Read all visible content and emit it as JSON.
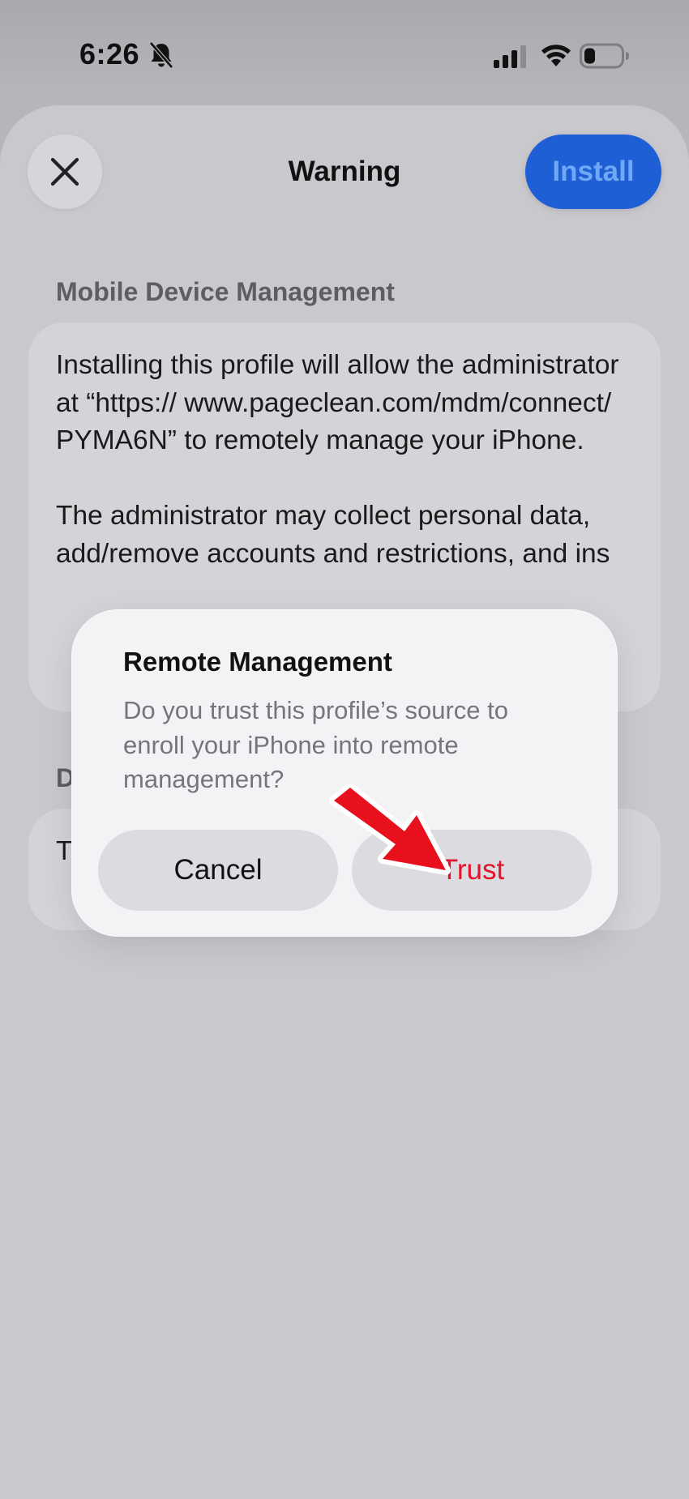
{
  "status_bar": {
    "time": "6:26"
  },
  "sheet": {
    "title": "Warning",
    "close_icon": "close-icon",
    "install_label": "Install",
    "accent_color": "#1f5fd6"
  },
  "mdm_section": {
    "header": "Mobile Device Management",
    "paragraph1": "Installing this profile will allow the administrator at “https:// www.pageclean.com/mdm/connect/ PYMA6N” to remotely manage your iPhone.",
    "paragraph2": "The administrator may collect personal data, add/remove accounts and restrictions, and ins"
  },
  "second_section": {
    "header": "D",
    "text": "T"
  },
  "alert": {
    "title": "Remote Management",
    "message": "Do you trust this profile’s source to enroll your iPhone into remote management?",
    "cancel_label": "Cancel",
    "trust_label": "Trust",
    "trust_color": "#e3142a"
  },
  "annotation": {
    "arrow_color": "#e8101c"
  }
}
